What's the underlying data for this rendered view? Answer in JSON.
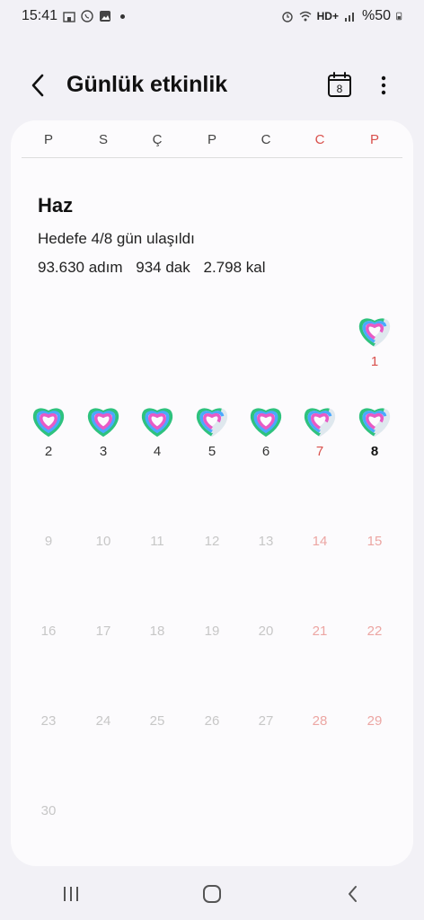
{
  "status_bar": {
    "time": "15:41",
    "network": "HD+",
    "battery": "%50",
    "left_icons": [
      "building-icon",
      "whatsapp-icon",
      "gallery-icon",
      "dot-icon"
    ],
    "right_icons": [
      "alarm-icon",
      "wifi-icon",
      "signal-icon",
      "battery-icon"
    ]
  },
  "header": {
    "title": "Günlük etkinlik",
    "calendar_day": "8"
  },
  "weekdays": [
    {
      "label": "P",
      "weekend": false
    },
    {
      "label": "S",
      "weekend": false
    },
    {
      "label": "Ç",
      "weekend": false
    },
    {
      "label": "P",
      "weekend": false
    },
    {
      "label": "C",
      "weekend": false
    },
    {
      "label": "C",
      "weekend": true
    },
    {
      "label": "P",
      "weekend": true
    }
  ],
  "summary": {
    "month": "Haz",
    "goal_text": "Hedefe 4/8 gün ulaşıldı",
    "steps": "93.630 adım",
    "minutes": "934 dak",
    "calories": "2.798 kal"
  },
  "calendar": {
    "days": [
      {
        "day": "1",
        "col": 6,
        "row": 0,
        "has_data": true,
        "goal_met": false
      },
      {
        "day": "2",
        "col": 0,
        "row": 1,
        "has_data": true,
        "goal_met": true
      },
      {
        "day": "3",
        "col": 1,
        "row": 1,
        "has_data": true,
        "goal_met": true
      },
      {
        "day": "4",
        "col": 2,
        "row": 1,
        "has_data": true,
        "goal_met": true
      },
      {
        "day": "5",
        "col": 3,
        "row": 1,
        "has_data": true,
        "goal_met": false
      },
      {
        "day": "6",
        "col": 4,
        "row": 1,
        "has_data": true,
        "goal_met": true
      },
      {
        "day": "7",
        "col": 5,
        "row": 1,
        "has_data": true,
        "goal_met": false
      },
      {
        "day": "8",
        "col": 6,
        "row": 1,
        "has_data": true,
        "goal_met": false,
        "today": true
      },
      {
        "day": "9",
        "col": 0,
        "row": 2,
        "has_data": false
      },
      {
        "day": "10",
        "col": 1,
        "row": 2,
        "has_data": false
      },
      {
        "day": "11",
        "col": 2,
        "row": 2,
        "has_data": false
      },
      {
        "day": "12",
        "col": 3,
        "row": 2,
        "has_data": false
      },
      {
        "day": "13",
        "col": 4,
        "row": 2,
        "has_data": false
      },
      {
        "day": "14",
        "col": 5,
        "row": 2,
        "has_data": false
      },
      {
        "day": "15",
        "col": 6,
        "row": 2,
        "has_data": false
      },
      {
        "day": "16",
        "col": 0,
        "row": 3,
        "has_data": false
      },
      {
        "day": "17",
        "col": 1,
        "row": 3,
        "has_data": false
      },
      {
        "day": "18",
        "col": 2,
        "row": 3,
        "has_data": false
      },
      {
        "day": "19",
        "col": 3,
        "row": 3,
        "has_data": false
      },
      {
        "day": "20",
        "col": 4,
        "row": 3,
        "has_data": false
      },
      {
        "day": "21",
        "col": 5,
        "row": 3,
        "has_data": false
      },
      {
        "day": "22",
        "col": 6,
        "row": 3,
        "has_data": false
      },
      {
        "day": "23",
        "col": 0,
        "row": 4,
        "has_data": false
      },
      {
        "day": "24",
        "col": 1,
        "row": 4,
        "has_data": false
      },
      {
        "day": "25",
        "col": 2,
        "row": 4,
        "has_data": false
      },
      {
        "day": "26",
        "col": 3,
        "row": 4,
        "has_data": false
      },
      {
        "day": "27",
        "col": 4,
        "row": 4,
        "has_data": false
      },
      {
        "day": "28",
        "col": 5,
        "row": 4,
        "has_data": false
      },
      {
        "day": "29",
        "col": 6,
        "row": 4,
        "has_data": false
      },
      {
        "day": "30",
        "col": 0,
        "row": 5,
        "has_data": false
      }
    ],
    "ring_colors": {
      "outer": "#2ec27e",
      "middle": "#4aa8ff",
      "inner": "#e85ac6"
    },
    "weekend_color": "#d9504c"
  },
  "navbar": {
    "icons": [
      "recent-apps-icon",
      "home-icon",
      "back-icon"
    ]
  }
}
